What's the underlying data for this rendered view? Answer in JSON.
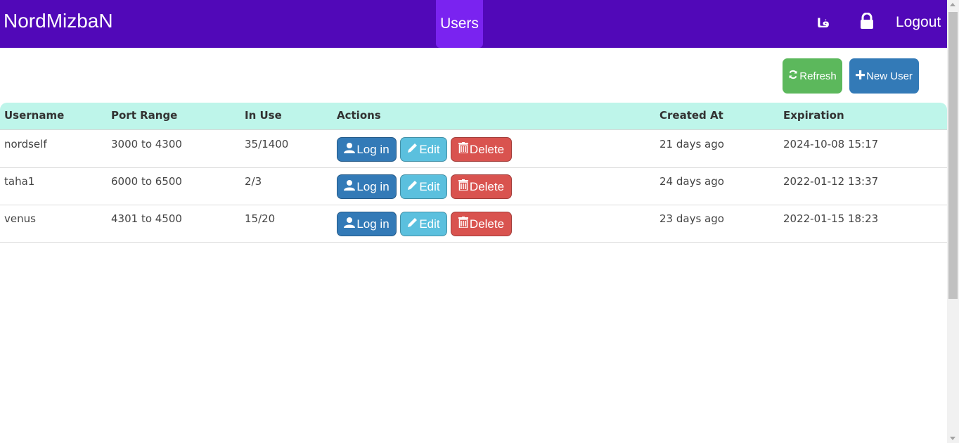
{
  "navbar": {
    "brand": "NordMizbaN",
    "users_tab": "Users",
    "lang_toggle": "فا",
    "lock_icon": "lock-icon",
    "logout": "Logout",
    "bg_color": "#5108b8",
    "active_tab_color": "#7a23f0"
  },
  "toolbar": {
    "refresh_label": "Refresh",
    "refresh_icon": "refresh-icon",
    "new_user_label": "New User",
    "new_user_icon": "plus-icon"
  },
  "table": {
    "headers": {
      "username": "Username",
      "port_range": "Port Range",
      "in_use": "In Use",
      "actions": "Actions",
      "created_at": "Created At",
      "expiration": "Expiration"
    },
    "action_labels": {
      "login": "Log in",
      "edit": "Edit",
      "delete": "Delete"
    },
    "rows": [
      {
        "username": "nordself",
        "port_range": "3000 to 4300",
        "in_use": "35/1400",
        "created_at": "21 days ago",
        "expiration": "2024-10-08 15:17"
      },
      {
        "username": "taha1",
        "port_range": "6000 to 6500",
        "in_use": "2/3",
        "created_at": "24 days ago",
        "expiration": "2022-01-12 13:37"
      },
      {
        "username": "venus",
        "port_range": "4301 to 4500",
        "in_use": "15/20",
        "created_at": "23 days ago",
        "expiration": "2022-01-15 18:23"
      }
    ]
  },
  "colors": {
    "header_row_bg": "#bef5ea",
    "success": "#5cb85c",
    "primary": "#337ab7",
    "info": "#5bc0de",
    "danger": "#d9534f"
  }
}
